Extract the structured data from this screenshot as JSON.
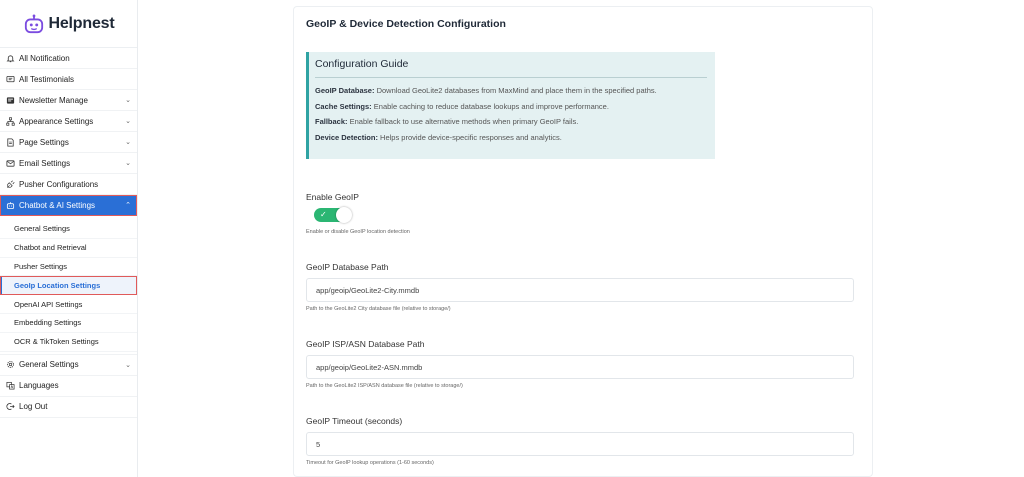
{
  "brand": {
    "name": "Helpnest",
    "accent": "#2a6fd6",
    "logo_color": "#7b4ce0"
  },
  "sidebar": {
    "items": [
      {
        "label": "All Notification",
        "icon": "bell-icon",
        "chevron": false
      },
      {
        "label": "All Testimonials",
        "icon": "chat-icon",
        "chevron": false
      },
      {
        "label": "Newsletter Manage",
        "icon": "newsletter-icon",
        "chevron": true
      },
      {
        "label": "Appearance Settings",
        "icon": "sitemap-icon",
        "chevron": true
      },
      {
        "label": "Page Settings",
        "icon": "page-icon",
        "chevron": true
      },
      {
        "label": "Email Settings",
        "icon": "mail-icon",
        "chevron": true
      },
      {
        "label": "Pusher Configurations",
        "icon": "plug-icon",
        "chevron": false
      },
      {
        "label": "Chatbot & AI Settings",
        "icon": "robot-icon",
        "chevron": true,
        "active": true
      }
    ],
    "submenu": [
      {
        "label": "General Settings"
      },
      {
        "label": "Chatbot and Retrieval"
      },
      {
        "label": "Pusher Settings"
      },
      {
        "label": "GeoIp Location Settings",
        "active": true
      },
      {
        "label": "OpenAI API Settings"
      },
      {
        "label": "Embedding Settings"
      },
      {
        "label": "OCR & TikToken Settings"
      }
    ],
    "bottom_items": [
      {
        "label": "General Settings",
        "icon": "gear-icon",
        "chevron": true
      },
      {
        "label": "Languages",
        "icon": "language-icon",
        "chevron": false
      },
      {
        "label": "Log Out",
        "icon": "logout-icon",
        "chevron": false
      }
    ]
  },
  "main": {
    "title": "GeoIP & Device Detection Configuration",
    "guide": {
      "title": "Configuration Guide",
      "lines": [
        {
          "key": "GeoIP Database:",
          "text": " Download GeoLite2 databases from MaxMind and place them in the specified paths."
        },
        {
          "key": "Cache Settings:",
          "text": " Enable caching to reduce database lookups and improve performance."
        },
        {
          "key": "Fallback:",
          "text": " Enable fallback to use alternative methods when primary GeoIP fails."
        },
        {
          "key": "Device Detection:",
          "text": " Helps provide device-specific responses and analytics."
        }
      ]
    },
    "enable_geoip": {
      "label": "Enable GeoIP",
      "on": true,
      "help": "Enable or disable GeoIP location detection"
    },
    "db_path": {
      "label": "GeoIP Database Path",
      "value": "app/geoip/GeoLite2-City.mmdb",
      "help": "Path to the GeoLite2 City database file (relative to storage/)"
    },
    "isp_path": {
      "label": "GeoIP ISP/ASN Database Path",
      "value": "app/geoip/GeoLite2-ASN.mmdb",
      "help": "Path to the GeoLite2 ISP/ASN database file (relative to storage/)"
    },
    "timeout": {
      "label": "GeoIP Timeout (seconds)",
      "value": "5",
      "help": "Timeout for GeoIP lookup operations (1-60 seconds)"
    }
  }
}
